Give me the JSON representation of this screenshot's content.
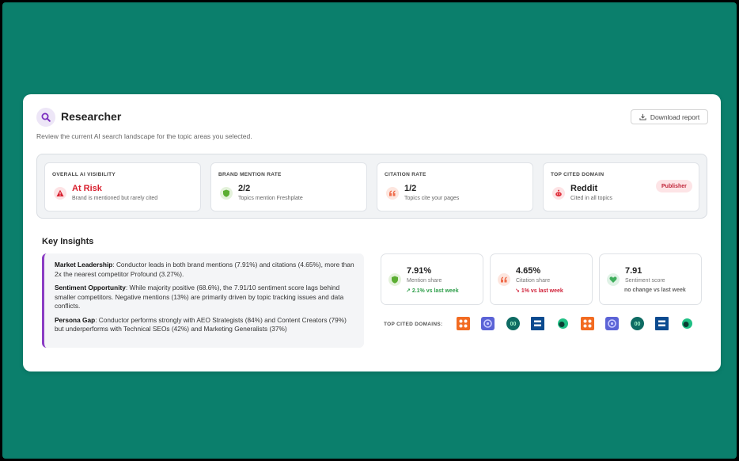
{
  "header": {
    "title": "Researcher",
    "subtitle": "Review the current AI search landscape for the topic areas you selected.",
    "download_label": "Download report"
  },
  "metrics": [
    {
      "label": "OVERALL AI VISIBILITY",
      "value": "At Risk",
      "desc": "Brand is mentioned but rarely cited",
      "icon": "warning-icon",
      "color": "#d81f2e"
    },
    {
      "label": "BRAND MENTION RATE",
      "value": "2/2",
      "desc": "Topics mention Freshplate",
      "icon": "shield-icon",
      "color": "#5bae32"
    },
    {
      "label": "CITATION RATE",
      "value": "1/2",
      "desc": "Topics cite your pages",
      "icon": "quote-icon",
      "color": "#ef6b4a"
    },
    {
      "label": "TOP CITED DOMAIN",
      "value": "Reddit",
      "desc": "Cited in all topics",
      "icon": "reddit-icon",
      "badge": "Publisher",
      "color": "#e0303c"
    }
  ],
  "insights": {
    "heading": "Key Insights",
    "items": [
      {
        "title": "Market Leadership",
        "text": ": Conductor leads in both brand mentions (7.91%) and citations (4.65%), more than 2x the nearest competitor Profound (3.27%)."
      },
      {
        "title": "Sentiment Opportunity",
        "text": ": While majority positive (68.6%), the 7.91/10 sentiment score lags behind smaller competitors. Negative mentions (13%) are primarily driven by topic tracking issues and data conflicts."
      },
      {
        "title": "Persona Gap",
        "text": ": Conductor performs strongly with AEO Strategists (84%) and Content Creators (79%) but underperforms with Technical SEOs (42%) and Marketing Generalists (37%)"
      }
    ]
  },
  "stats": [
    {
      "value": "7.91%",
      "label": "Mention share",
      "trend": "2.1% vs last week",
      "direction": "up",
      "arrow": "↗",
      "icon": "shield-icon"
    },
    {
      "value": "4.65%",
      "label": "Citation share",
      "trend": "1% vs last week",
      "direction": "down",
      "arrow": "↘",
      "icon": "quote-icon"
    },
    {
      "value": "7.91",
      "label": "Sentiment score",
      "trend": "no change vs last week",
      "direction": "flat",
      "arrow": "",
      "icon": "heart-icon"
    }
  ],
  "domains": {
    "label": "TOP CITED DOMAINS:",
    "logos": [
      "orange-grid-logo",
      "blue-gear-logo",
      "teal-oo-logo",
      "navy-bars-logo",
      "green-dot-logo",
      "orange-grid-logo",
      "blue-gear-logo",
      "teal-oo-logo",
      "navy-bars-logo",
      "green-dot-logo"
    ],
    "logo_text": "00"
  },
  "colors": {
    "background": "#0b7f6c",
    "accent_purple": "#8b3dc4",
    "risk_red": "#d81f2e",
    "positive_green": "#2e9e4a"
  }
}
